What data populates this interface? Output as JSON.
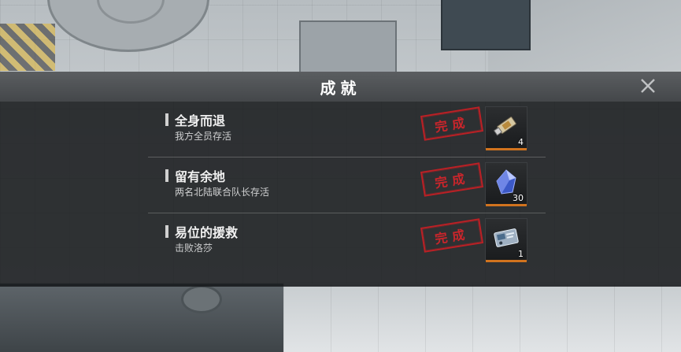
{
  "dialog": {
    "title": "成就"
  },
  "achievements": [
    {
      "name": "全身而退",
      "description": "我方全员存活",
      "status": "完成",
      "reward_icon": "usb-key-icon",
      "reward_count": "4"
    },
    {
      "name": "留有余地",
      "description": "两名北陆联合队长存活",
      "status": "完成",
      "reward_icon": "blue-crystal-icon",
      "reward_count": "30"
    },
    {
      "name": "易位的援救",
      "description": "击败洛莎",
      "status": "完成",
      "reward_icon": "id-card-icon",
      "reward_count": "1"
    }
  ],
  "colors": {
    "stamp_red": "#d8252b",
    "reward_underline": "#d1731e"
  }
}
